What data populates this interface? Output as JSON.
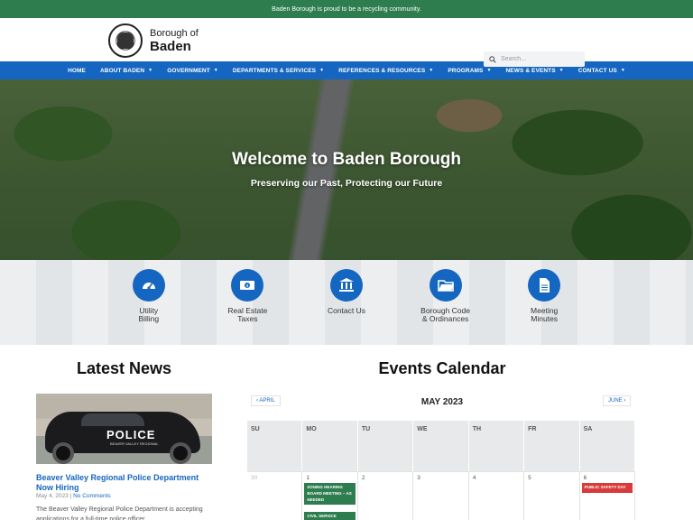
{
  "topbar": {
    "text": "Baden Borough is proud to be a recycling community."
  },
  "header": {
    "logo_line1": "Borough of",
    "logo_line2": "Baden",
    "search_placeholder": "Search..."
  },
  "nav": [
    {
      "label": "HOME",
      "has_dropdown": false
    },
    {
      "label": "ABOUT BADEN",
      "has_dropdown": true
    },
    {
      "label": "GOVERNMENT",
      "has_dropdown": true
    },
    {
      "label": "DEPARTMENTS & SERVICES",
      "has_dropdown": true
    },
    {
      "label": "REFERENCES & RESOURCES",
      "has_dropdown": true
    },
    {
      "label": "PROGRAMS",
      "has_dropdown": true
    },
    {
      "label": "NEWS & EVENTS",
      "has_dropdown": true
    },
    {
      "label": "CONTACT US",
      "has_dropdown": true
    }
  ],
  "hero": {
    "title": "Welcome to Baden Borough",
    "subtitle": "Preserving our Past, Protecting our Future"
  },
  "quick_links": [
    {
      "label": "Utility\nBilling",
      "icon": "gauge-icon"
    },
    {
      "label": "Real Estate\nTaxes",
      "icon": "money-icon"
    },
    {
      "label": "Contact Us",
      "icon": "building-icon"
    },
    {
      "label": "Borough Code\n& Ordinances",
      "icon": "folder-icon"
    },
    {
      "label": "Meeting\nMinutes",
      "icon": "document-icon"
    }
  ],
  "news": {
    "heading": "Latest News",
    "image_word": "POLICE",
    "image_subtext": "BEAVER VALLEY REGIONAL",
    "post_title": "Beaver Valley Regional Police Department Now Hiring",
    "post_date": "May 4, 2023",
    "post_comments": "No Comments",
    "post_excerpt": "The Beaver Valley Regional Police Department is accepting applications for a full-time police officer."
  },
  "calendar": {
    "heading": "Events Calendar",
    "prev_label": "APRIL",
    "next_label": "JUNE",
    "month_label": "MAY 2023",
    "weekdays": [
      "SU",
      "MO",
      "TU",
      "WE",
      "TH",
      "FR",
      "SA"
    ],
    "first_week_days": [
      "30",
      "1",
      "2",
      "3",
      "4",
      "5",
      "6"
    ],
    "events": {
      "mo_1": "ZONING HEARING BOARD MEETING – AS NEEDED",
      "mo_2": "CIVIL SERVICE",
      "sa_1": "PUBLIC SAFETY DAY"
    }
  },
  "colors": {
    "topbar": "#2e7d4f",
    "nav": "#1566c0",
    "icon_circle": "#1566c0",
    "event_green": "#2e7d4f",
    "event_red": "#d83b3b"
  }
}
